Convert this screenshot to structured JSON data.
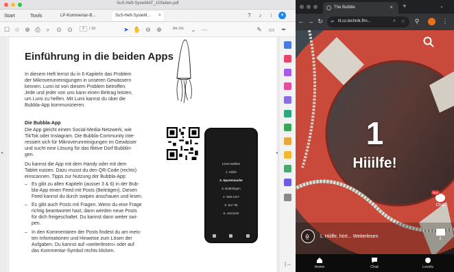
{
  "pdf_window": {
    "title": "SuS-Heft-SysteMAT_10Seiten.pdf",
    "menu": [
      "Start",
      "Tools"
    ],
    "tabs": [
      {
        "label": "LP-Kommentar-B..."
      },
      {
        "label": "SuS-Heft-SysteM..."
      }
    ],
    "toolbar": {
      "page_current": "2",
      "page_total": "/ 10",
      "zoom": "84.1%"
    }
  },
  "pdf_page": {
    "heading": "Einführung in die beiden Apps",
    "intro_lines": [
      "In diesem Heft lernst du in 6 Kapiteln das Problem",
      "der Mikroverunreinigungen in unseren Gewässern",
      "kennen. Lumi ist von diesem Problem betroffen.",
      "Jede und jeder von uns kann einen Beitrag leisten,",
      "um Lumi zu helfen. Mit Lumi kannst du über die",
      "Bubbla-App kommunizieren."
    ],
    "subheading": "Die Bubbla-App",
    "app_lines": [
      "Die App gleicht einem Social-Media-Netzwerk, wie",
      "TikTok oder Instagram. Die Bubbla-Community inte-",
      "ressiert sich für Mikroverunreinigungen im Gewässer",
      "und sucht eine Lösung für das fiktive Dorf Bubblin-",
      "gen."
    ],
    "usage_lines": [
      "Du kannst die App mit dem Handy oder mit dem",
      "Tablet nutzen. Dazu musst du den QR-Code (rechts)",
      "einscannen. Tipps zur Nutzung der Bubbla-App:"
    ],
    "bullets": [
      [
        "Es gibt zu allen Kapiteln (ausser 3 & 6) in der Bub-",
        "bla-App einen Feed mit Posts (Beiträgen). Diesen",
        "Feed kannst du durch swipen anschauen und lesen."
      ],
      [
        "Es gibt auch Posts mit Fragen. Wenn du eine Frage",
        "richtig beantwortet hast, dann werden neue Posts",
        "für dich freigeschaltet. Du kannst dann weiter swi-",
        "pen."
      ],
      [
        "In den Kommentaren der Posts findest du am meis-",
        "ten Informationen und Hinweise zum Lösen der",
        "Aufgaben. Du kannst auf «weiterlesen» oder auf",
        "das Kommentar-Symbol rechts klicken."
      ]
    ],
    "phone_menu": {
      "header": "Level wählen",
      "items": [
        "1. Hiiilfe",
        "2. Spurensuche",
        "3. Bubblingen",
        "4. Was tun?",
        "5. Zur Tat",
        "6. Und jetzt"
      ]
    }
  },
  "browser": {
    "tab_title": "The Bubble",
    "url": "lit.cs.technik.fhn...",
    "feed": {
      "post_number": "1",
      "post_title": "Hiiilfe!",
      "post_caption": "1. Hiiilfe, hört... Weiterlesen",
      "chat_badge": "Neu",
      "chat_label": "Chat",
      "comment_count": "2"
    },
    "bottom_nav": [
      {
        "label": "Home",
        "icon": "home-icon"
      },
      {
        "label": "Chat",
        "icon": "chat-icon"
      },
      {
        "label": "Levels",
        "icon": "levels-icon"
      }
    ]
  },
  "colors": {
    "accent_red": "#e8312b",
    "lifebuoy_red": "#c94a3a"
  }
}
